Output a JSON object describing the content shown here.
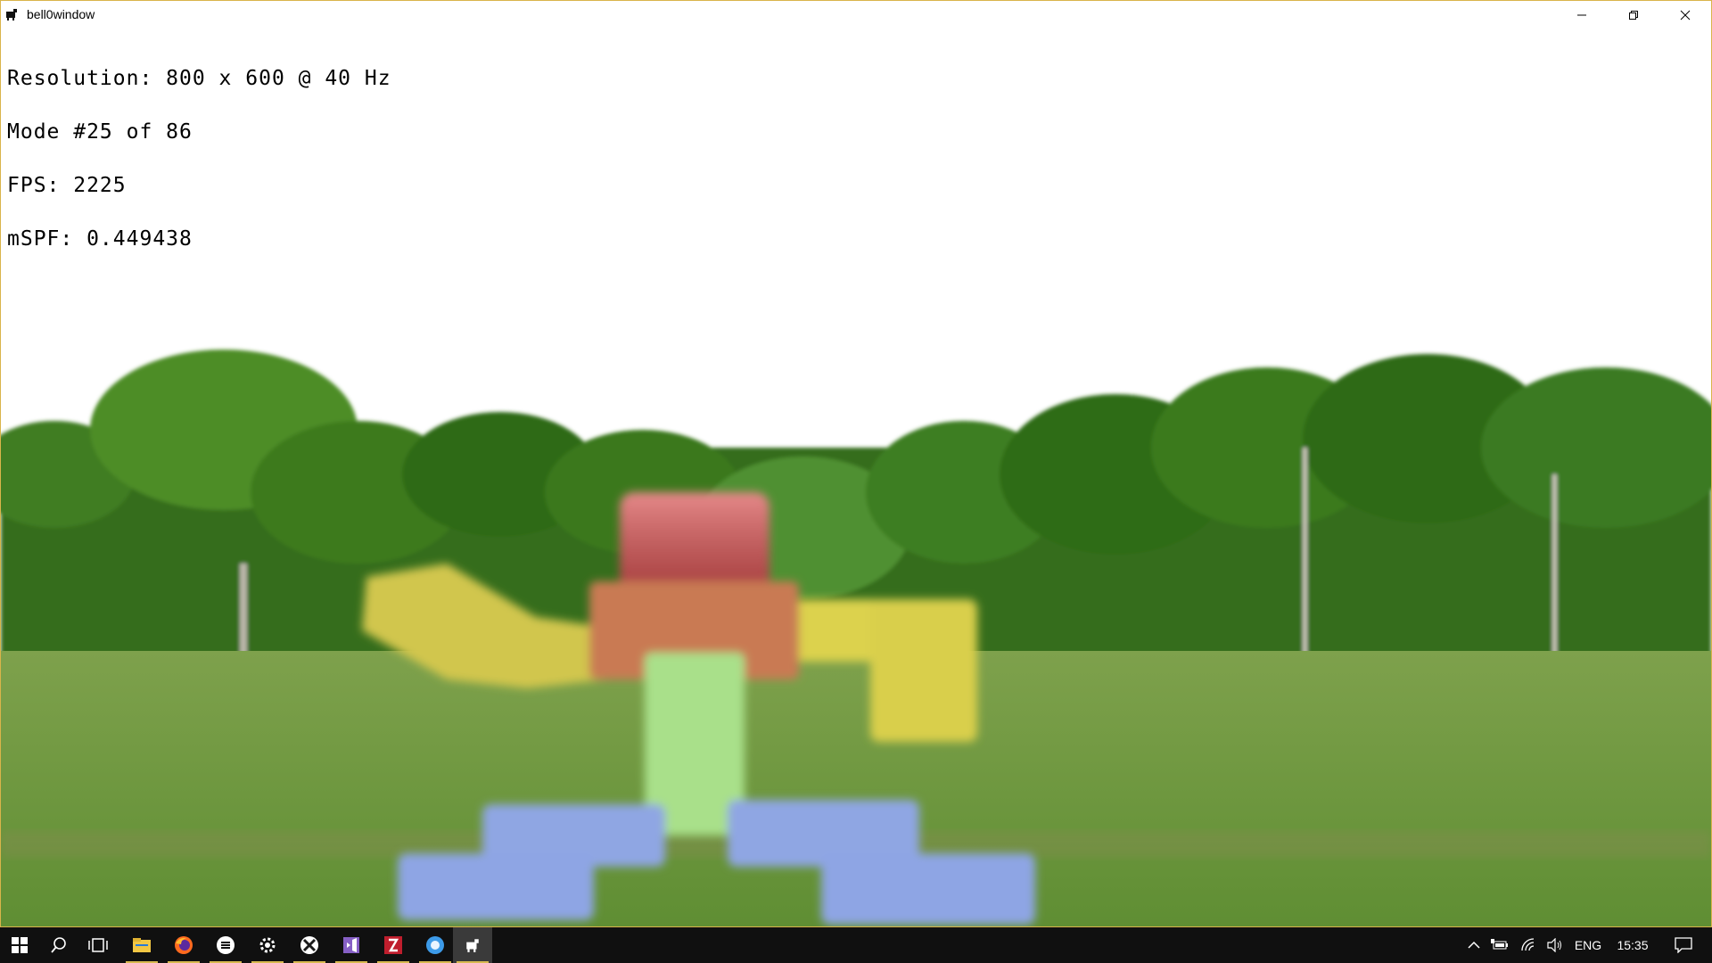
{
  "window": {
    "title": "bell0window",
    "controls": [
      "minimize-icon",
      "restore-icon",
      "close-icon"
    ]
  },
  "hud": {
    "resolution": "Resolution: 800 x 600 @ 40 Hz",
    "mode": "Mode #25 of 86",
    "fps": "FPS: 2225",
    "mspf": "mSPF: 0.449438"
  },
  "scene": {
    "sky_color": "#ffffff",
    "grass_color": "#6f9a3f",
    "tree_color": "#3d7a1e",
    "figure_colors": {
      "head": "#d84a4a",
      "torso": "#c97a52",
      "arms": "#d9d24e",
      "spine": "#a9e08a",
      "feet": "#8fa6e3"
    }
  },
  "taskbar": {
    "items": [
      {
        "icon": "windows-start-icon"
      },
      {
        "icon": "search-icon"
      },
      {
        "icon": "task-view-icon"
      },
      {
        "icon": "file-explorer-icon"
      },
      {
        "icon": "firefox-icon"
      },
      {
        "icon": "media-player-icon"
      },
      {
        "icon": "settings-icon"
      },
      {
        "icon": "xbox-icon"
      },
      {
        "icon": "visual-studio-icon"
      },
      {
        "icon": "filezilla-icon"
      },
      {
        "icon": "app-circle-icon"
      },
      {
        "icon": "bell0window-icon"
      }
    ],
    "tray": {
      "language": "ENG",
      "time": "15:35",
      "icons": [
        "chevron-up-icon",
        "battery-icon",
        "wifi-icon",
        "volume-icon",
        "notification-icon"
      ]
    },
    "accent_color": "#d7b94f"
  }
}
